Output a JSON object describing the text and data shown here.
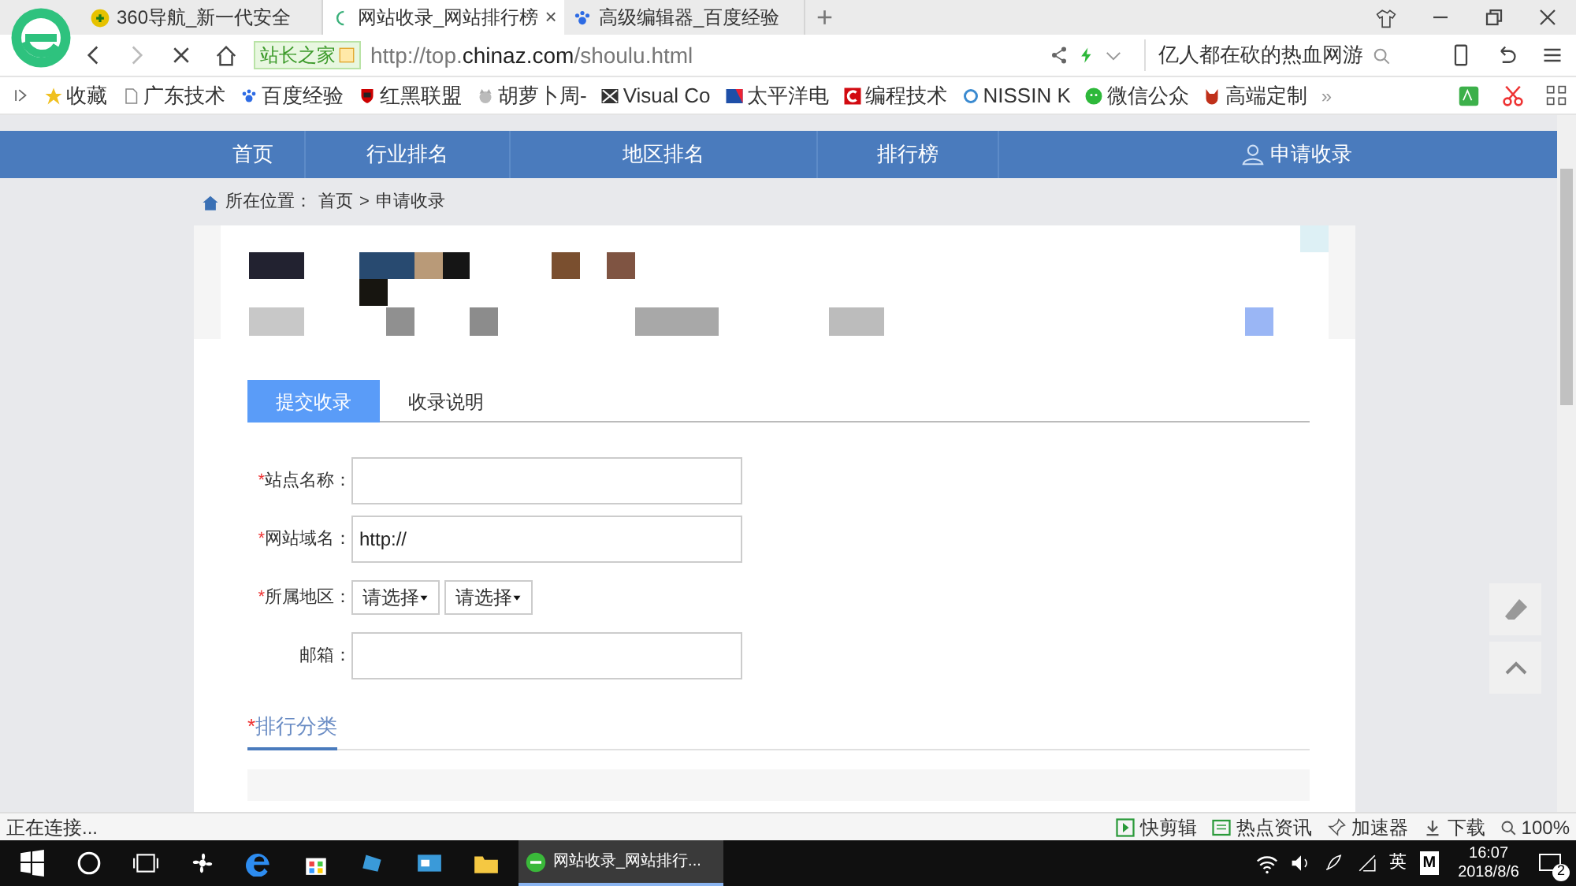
{
  "browser": {
    "tabs": [
      {
        "label": "360导航_新一代安全",
        "selected": false
      },
      {
        "label": "网站收录_网站排行榜",
        "selected": true,
        "close": "×"
      },
      {
        "label": "高级编辑器_百度经验",
        "selected": false
      }
    ],
    "new_tab": "+",
    "address": {
      "site_badge": "站长之家",
      "url_prefix": "http://top.",
      "url_domain": "chinaz.com",
      "url_suffix": "/shoulu.html"
    },
    "search_box": {
      "value": "亿人都在砍的热血网游"
    },
    "bookmarks": [
      {
        "label": "收藏"
      },
      {
        "label": "广东技术"
      },
      {
        "label": "百度经验"
      },
      {
        "label": "红黑联盟"
      },
      {
        "label": "胡萝卜周-"
      },
      {
        "label": "Visual Co"
      },
      {
        "label": "太平洋电"
      },
      {
        "label": "编程技术"
      },
      {
        "label": "NISSIN K"
      },
      {
        "label": "微信公众"
      },
      {
        "label": "高端定制"
      }
    ],
    "bookmarks_more": "»"
  },
  "page": {
    "nav": [
      {
        "label": "首页"
      },
      {
        "label": "行业排名"
      },
      {
        "label": "地区排名"
      },
      {
        "label": "排行榜"
      }
    ],
    "nav_user_link": "申请收录",
    "breadcrumb": {
      "label": "所在位置：",
      "items": [
        "首页",
        "申请收录"
      ],
      "separator": ">"
    },
    "form_tabs": [
      {
        "label": "提交收录",
        "selected": true
      },
      {
        "label": "收录说明",
        "selected": false
      }
    ],
    "fields": [
      {
        "kind": "text",
        "mark": "*",
        "label": "站点名称："
      },
      {
        "kind": "text",
        "mark": "*",
        "label": "网站域名：",
        "value": "http://"
      },
      {
        "kind": "selects",
        "mark": "*",
        "label": "所属地区：",
        "selects": [
          "请选择",
          "请选择"
        ]
      },
      {
        "kind": "text",
        "label": "邮箱："
      }
    ],
    "section": {
      "mark": "*",
      "title": "排行分类"
    }
  },
  "status_bar": {
    "text": "正在连接...",
    "items": [
      {
        "label": "快剪辑"
      },
      {
        "label": "热点资讯"
      },
      {
        "label": "加速器"
      },
      {
        "label": "下载"
      }
    ],
    "zoom": "100%"
  },
  "taskbar": {
    "app": "网站收录_网站排行...",
    "ime": "英",
    "ime_mode": "M",
    "time": "16:07",
    "date": "2018/8/6",
    "notifications": "2"
  }
}
